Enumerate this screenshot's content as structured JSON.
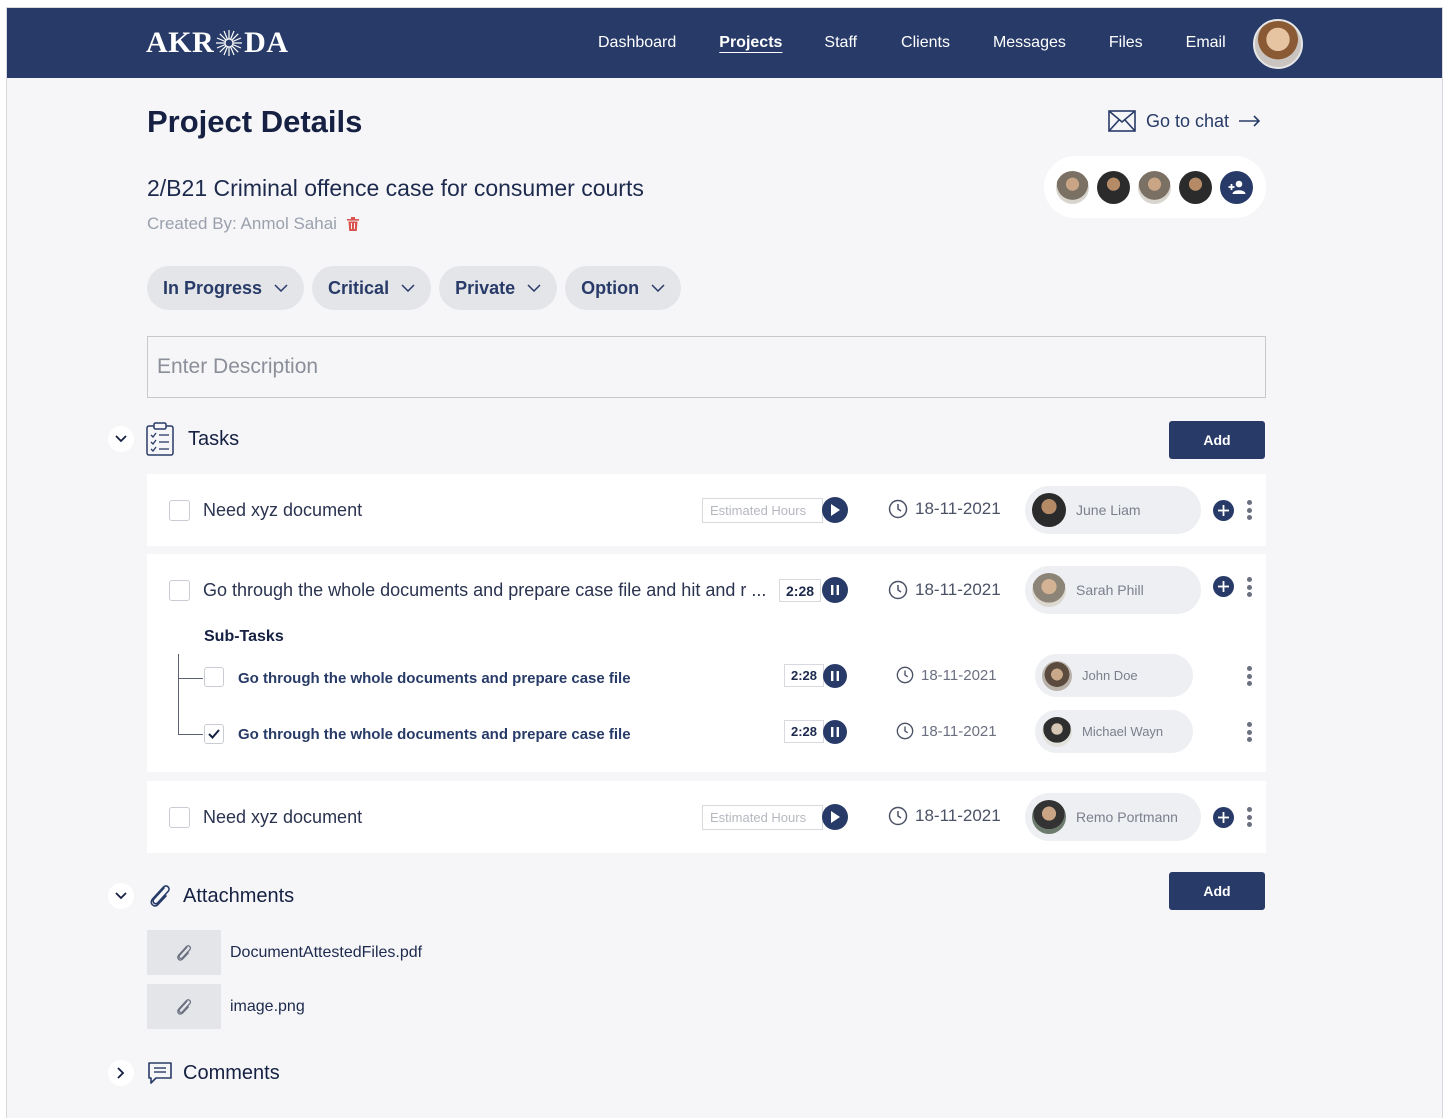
{
  "nav": {
    "logo": "AKRODA",
    "logo_parts": [
      "AKR",
      "DA"
    ],
    "links": [
      "Dashboard",
      "Projects",
      "Staff",
      "Clients",
      "Messages",
      "Files",
      "Email"
    ],
    "active_link": "Projects"
  },
  "page": {
    "title": "Project Details",
    "go_to_chat": "Go to chat",
    "project_name": "2/B21 Criminal offence case for consumer courts",
    "created_by": "Created By: Anmol Sahai"
  },
  "filters": [
    "In Progress",
    "Critical",
    "Private",
    "Option"
  ],
  "description": {
    "placeholder": "Enter Description",
    "value": ""
  },
  "tasks_section": {
    "label": "Tasks",
    "add_label": "Add",
    "subtasks_label": "Sub-Tasks",
    "estimated_placeholder": "Estimated Hours",
    "tasks": [
      {
        "title": "Need xyz document",
        "checked": false,
        "timer": null,
        "date": "18-11-2021",
        "assignee": "June Liam"
      },
      {
        "title": "Go through the whole documents and prepare case file and hit and r ...",
        "checked": false,
        "timer": "2:28",
        "date": "18-11-2021",
        "assignee": "Sarah Phill",
        "subtasks": [
          {
            "title": "Go through the whole documents and prepare case file",
            "checked": false,
            "timer": "2:28",
            "date": "18-11-2021",
            "assignee": "John Doe"
          },
          {
            "title": "Go through the whole documents and prepare case file",
            "checked": true,
            "timer": "2:28",
            "date": "18-11-2021",
            "assignee": "Michael Wayn"
          }
        ]
      },
      {
        "title": "Need xyz document",
        "checked": false,
        "timer": null,
        "date": "18-11-2021",
        "assignee": "Remo Portmann"
      }
    ]
  },
  "attachments_section": {
    "label": "Attachments",
    "add_label": "Add",
    "files": [
      "DocumentAttestedFiles.pdf",
      "image.png"
    ]
  },
  "comments_section": {
    "label": "Comments"
  },
  "colors": {
    "navy": "#283b68",
    "background": "#f6f6f8",
    "delete": "#d9534f"
  }
}
